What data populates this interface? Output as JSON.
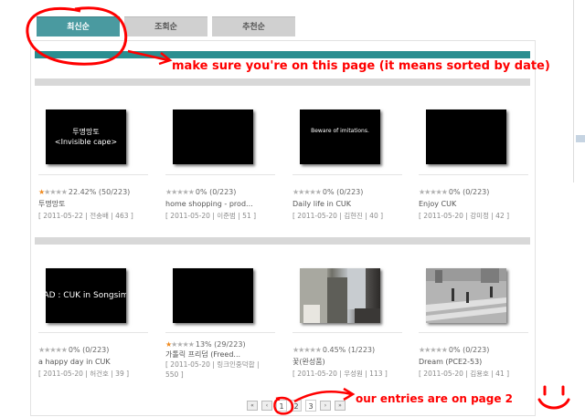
{
  "tabs": [
    {
      "label": "최신순",
      "active": true
    },
    {
      "label": "조회순",
      "active": false
    },
    {
      "label": "추천순",
      "active": false
    }
  ],
  "videos": [
    {
      "thumb_lines": [
        "투명망토",
        "<Invisible cape>"
      ],
      "stars_on": 1,
      "rating": "22.42% (50/223)",
      "title": "투명망토",
      "meta": "[ 2011-05-22 | 전송배 | 463 ]"
    },
    {
      "thumb_lines": [],
      "stars_on": 0,
      "rating": "0% (0/223)",
      "title": "home shopping - prod...",
      "meta": "[ 2011-05-20 | 이준범 | 51 ]"
    },
    {
      "thumb_lines": [
        "Beware of imitations."
      ],
      "stars_on": 0,
      "rating": "0% (0/223)",
      "title": "Daily life in CUK",
      "meta": "[ 2011-05-20 | 김현진 | 40 ]"
    },
    {
      "thumb_lines": [],
      "stars_on": 0,
      "rating": "0% (0/223)",
      "title": "Enjoy CUK",
      "meta": "[ 2011-05-20 | 강미정 | 42 ]"
    },
    {
      "thumb_lines": [
        "AD : CUK in Songsim"
      ],
      "stars_on": 0,
      "rating": "0% (0/223)",
      "title": "a happy day in CUK",
      "meta": "[ 2011-05-20 | 허건호 | 39 ]"
    },
    {
      "thumb_lines": [],
      "stars_on": 1,
      "rating": "13% (29/223)",
      "title": "가톨릭 프리덤 (Freed...",
      "meta": "[ 2011-05-20 | 링크인중덕합 | 550 ]"
    },
    {
      "thumb_lines": [],
      "stars_on": 0,
      "rating": "0.45% (1/223)",
      "title": "꽃(완성품)",
      "meta": "[ 2011-05-20 | 우성원 | 113 ]"
    },
    {
      "thumb_lines": [],
      "stars_on": 0,
      "rating": "0% (0/223)",
      "title": "Dream (PCE2-53)",
      "meta": "[ 2011-05-20 | 김용호 | 41 ]"
    }
  ],
  "pagination": {
    "first": "«",
    "prev": "‹",
    "pages": [
      "1",
      "2",
      "3"
    ],
    "current": "2",
    "next": "›",
    "last": "»"
  },
  "annotations": {
    "tab_note": "make sure you're on this page (it means sorted by date)",
    "page_note": "our entries are on page 2",
    "smiley": "˘◡˘"
  },
  "colors": {
    "accent_teal": "#2a8e90",
    "annotation_red": "#ff0000",
    "star_orange": "#f08a1e"
  }
}
